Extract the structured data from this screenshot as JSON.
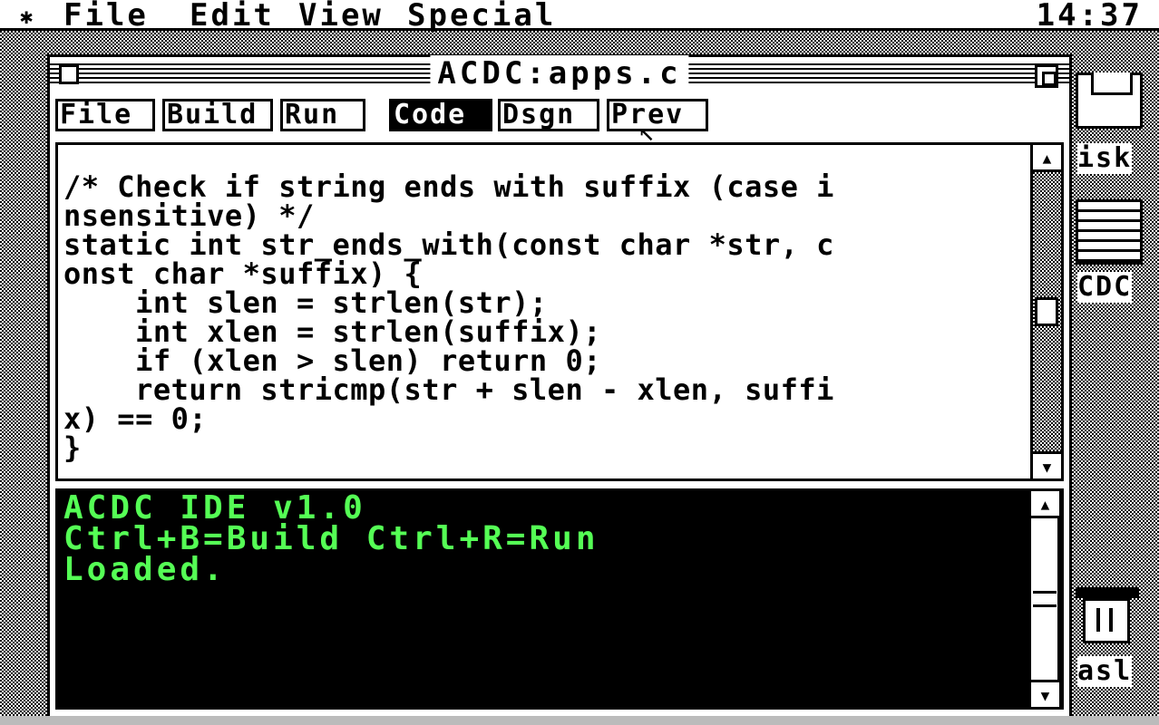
{
  "menubar": {
    "apple_glyph": "✱",
    "items": [
      "File",
      "Edit",
      "View",
      "Special"
    ],
    "clock": "14:37"
  },
  "desktop": {
    "disk_label": "isk",
    "app_label": "CDC",
    "trash_label": "asl"
  },
  "window": {
    "title": "ACDC:apps.c",
    "toolbar": {
      "buttons": [
        "File",
        "Build",
        "Run",
        "Code",
        "Dsgn",
        "Prev"
      ],
      "active": "Code"
    },
    "editor": {
      "lines": [
        "/* Check if string ends with suffix (case i",
        "nsensitive) */",
        "static int str_ends_with(const char *str, c",
        "onst char *suffix) {",
        "    int slen = strlen(str);",
        "    int xlen = strlen(suffix);",
        "    if (xlen > slen) return 0;",
        "    return stricmp(str + slen - xlen, suffi",
        "x) == 0;",
        "}"
      ]
    },
    "console": {
      "lines": [
        "ACDC IDE v1.0",
        "Ctrl+B=Build Ctrl+R=Run",
        "Loaded."
      ],
      "text_color": "#55ff55"
    }
  }
}
